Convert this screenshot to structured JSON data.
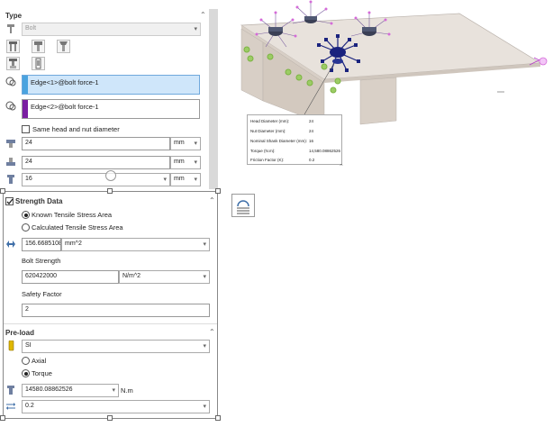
{
  "type_section": {
    "title": "Type",
    "bolt_select": "Bolt"
  },
  "selections": {
    "edge1": "Edge<1>@bolt force-1",
    "edge2": "Edge<2>@bolt force-1",
    "edge1_color": "#4aa3df",
    "edge2_color": "#7b1fa2"
  },
  "same_head_nut": {
    "label": "Same head and nut diameter",
    "checked": false
  },
  "head_diameter": {
    "value": "24",
    "unit": "mm"
  },
  "nut_diameter": {
    "value": "24",
    "unit": "mm"
  },
  "shank_diameter": {
    "value": "16",
    "unit": "mm"
  },
  "strength": {
    "title": "Strength Data",
    "checked": true,
    "option_known": "Known Tensile Stress Area",
    "option_calculated": "Calculated Tensile Stress Area",
    "selected": "known",
    "area_value": "156.6685108",
    "area_unit": "mm^2",
    "bolt_strength_label": "Bolt Strength",
    "bolt_strength_value": "620422000",
    "bolt_strength_unit": "N/m^2",
    "safety_factor_label": "Safety Factor",
    "safety_factor_value": "2"
  },
  "preload": {
    "title": "Pre-load",
    "unit_system": "SI",
    "option_axial": "Axial",
    "option_torque": "Torque",
    "selected": "torque",
    "torque_value": "14580.08862526",
    "torque_unit": "N.m",
    "friction_value": "0.2"
  },
  "tooltip": {
    "rows": [
      {
        "label": "Head Diameter (mm):",
        "value": "24"
      },
      {
        "label": "Nut Diameter (mm):",
        "value": "24"
      },
      {
        "label": "Nominal Shank Diameter (mm):",
        "value": "16"
      },
      {
        "label": "Torque (N.m):",
        "value": "14,580.08862526"
      },
      {
        "label": "Friction Factor (K):",
        "value": "0.2"
      }
    ]
  },
  "colors": {
    "accent_blue": "#1a237e",
    "plate": "#e8e2dc",
    "leg": "#d8cfc6",
    "purple": "#b53cc7"
  }
}
